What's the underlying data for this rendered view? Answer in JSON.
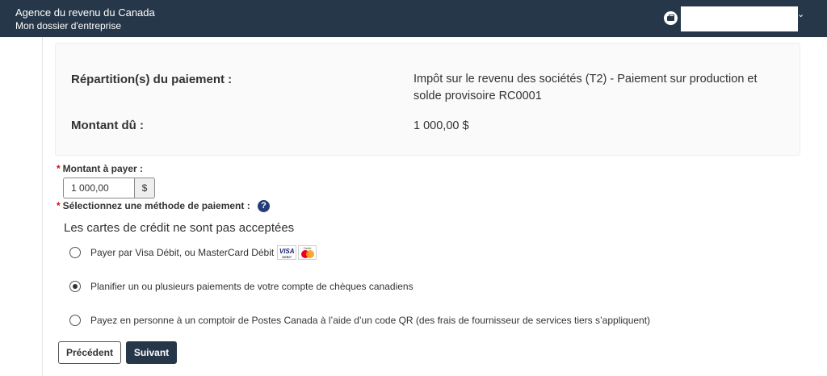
{
  "header": {
    "agency": "Agence du revenu du Canada",
    "dossier": "Mon dossier d'entreprise",
    "account_icon": "briefcase-icon",
    "menu_icon": "chevron-down-icon"
  },
  "summary": {
    "allocation_label": "Répartition(s) du paiement :",
    "allocation_value_line1": "Impôt sur le revenu des sociétés (T2) - Paiement sur production et",
    "allocation_value_line2": "solde provisoire RC0001",
    "due_label": "Montant dû :",
    "due_value": "1 000,00 $"
  },
  "form": {
    "required_marker": "*",
    "amount_label": "Montant à payer :",
    "amount_value": "1 000,00",
    "currency": "$",
    "method_label": "Sélectionnez une méthode de paiement :",
    "help_glyph": "?",
    "no_credit": "Les cartes de crédit ne sont pas acceptées",
    "options": [
      {
        "label": "Payer par Visa Débit, ou MasterCard Débit",
        "checked": false
      },
      {
        "label": "Planifier un ou plusieurs paiements de votre compte de chèques canadiens",
        "checked": true
      },
      {
        "label": "Payez en personne à un comptoir de Postes Canada à l’aide d’un code QR (des frais de fournisseur de services tiers s’appliquent)",
        "checked": false
      }
    ],
    "visa_text": "VISA",
    "visa_sub": "DEBIT",
    "mc_sub": "Debit"
  },
  "buttons": {
    "previous": "Précédent",
    "next": "Suivant"
  },
  "colors": {
    "header_bg": "#26374a",
    "required": "#d3080c",
    "help_icon": "#243c78"
  }
}
